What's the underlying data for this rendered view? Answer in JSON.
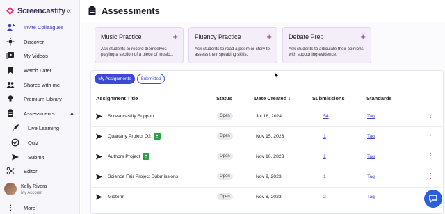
{
  "brand": {
    "name": "Screencastify"
  },
  "sidebar": {
    "collapse_icon": "double-chevron-left-icon",
    "items": [
      {
        "label": "Invite Colleagues",
        "icon": "add-user-icon"
      },
      {
        "label": "Discover",
        "icon": "sun-icon"
      },
      {
        "label": "My Videos",
        "icon": "video-library-icon"
      },
      {
        "label": "Watch Later",
        "icon": "bookmark-icon"
      },
      {
        "label": "Shared with me",
        "icon": "people-icon"
      },
      {
        "label": "Premium Library",
        "icon": "lightbulb-icon"
      },
      {
        "label": "Assessments",
        "icon": "clipboard-icon"
      },
      {
        "label": "Live Learning",
        "icon": "rocket-icon"
      },
      {
        "label": "Quiz",
        "icon": "check-badge-icon"
      },
      {
        "label": "Submit",
        "icon": "send-icon"
      },
      {
        "label": "Editor",
        "icon": "scissors-icon"
      },
      {
        "label": "More",
        "icon": "more-vertical-icon"
      }
    ],
    "user": {
      "name": "Kelly Rivera",
      "subtitle": "My Account"
    }
  },
  "page": {
    "title": "Assessments"
  },
  "cards": [
    {
      "title": "Music Practice",
      "desc": "Ask students to record themselves playing a section of a piece of music..."
    },
    {
      "title": "Fluency Practice",
      "desc": "Ask students to read a poem or story to assess their speaking skills."
    },
    {
      "title": "Debate Prep",
      "desc": "Ask students to articulate their opinions with supporting evidence."
    }
  ],
  "tabs": {
    "active": "My Assignments",
    "inactive": "Submitted"
  },
  "table": {
    "headers": [
      "Assignment Title",
      "Status",
      "Date Created",
      "Submissions",
      "Standards"
    ],
    "sort_indicator": "↓",
    "rows": [
      {
        "title": "Screencastify Support",
        "status": "Open",
        "date": "Jul 18, 2024",
        "submissions": "54",
        "standards": "Tag",
        "classroom": false
      },
      {
        "title": "Quarterly Project Q2",
        "status": "Open",
        "date": "Nov 15, 2023",
        "submissions": "1",
        "standards": "Tag",
        "classroom": true
      },
      {
        "title": "Authors Project",
        "status": "Open",
        "date": "Nov 10, 2023",
        "submissions": "1",
        "standards": "Tag",
        "classroom": true
      },
      {
        "title": "Science Fair Project Submissions",
        "status": "Open",
        "date": "Nov 9, 2023",
        "submissions": "1",
        "standards": "Tag",
        "classroom": false
      },
      {
        "title": "Midterm",
        "status": "Open",
        "date": "Nov 8, 2023",
        "submissions": "2",
        "standards": "Tag",
        "classroom": false
      }
    ]
  },
  "colors": {
    "accent": "#3b49d6",
    "brand": "#e6357c",
    "card_bg": "#f3eef8",
    "chat": "#2a5fd8"
  }
}
